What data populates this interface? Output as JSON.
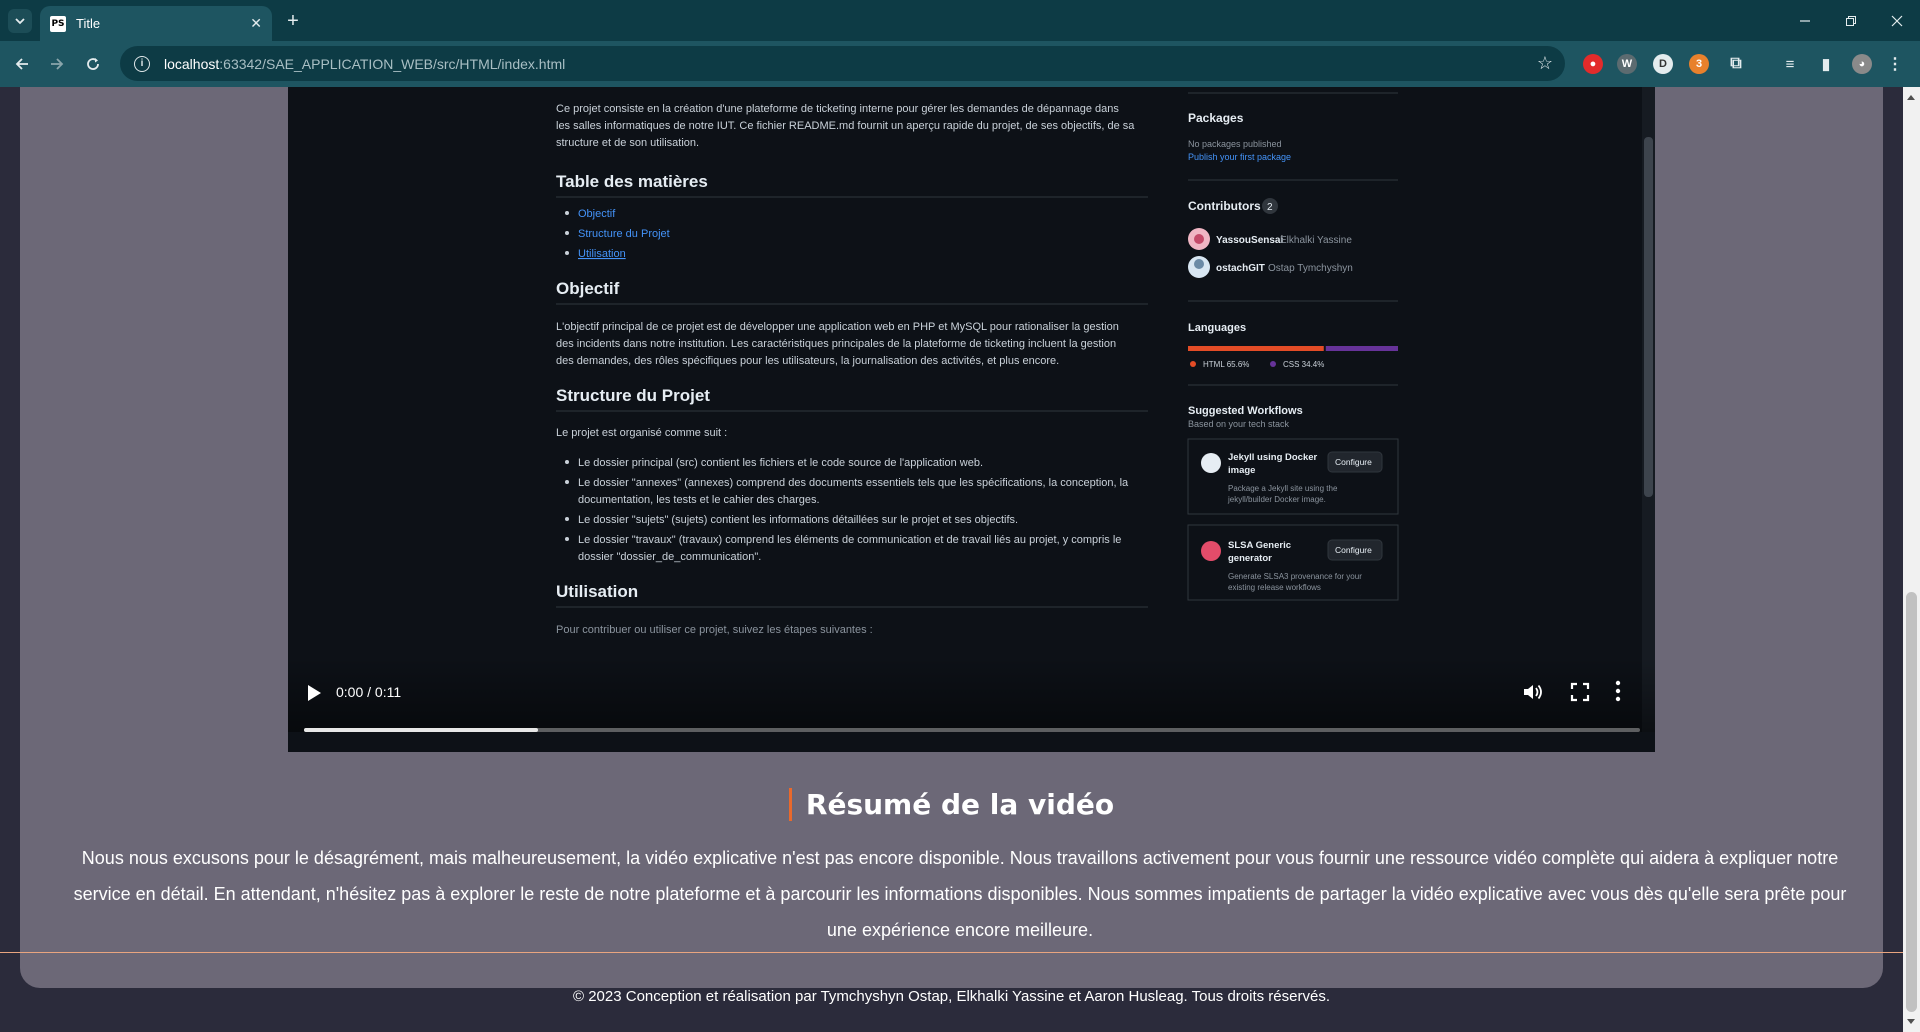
{
  "browser": {
    "tab_title": "Title",
    "tab_favicon_text": "PS",
    "url_host": "localhost",
    "url_rest": ":63342/SAE_APPLICATION_WEB/src/HTML/index.html",
    "extension_badge": "3"
  },
  "video_frame": {
    "intro_line1": "Ce projet consiste en la création d'une plateforme de ticketing interne pour gérer les demandes de dépannage dans",
    "intro_line2": "les salles informatiques de notre IUT. Ce fichier README.md fournit un aperçu rapide du projet, de ses objectifs, de sa",
    "intro_line3": "structure et de son utilisation.",
    "toc_heading": "Table des matières",
    "toc_items": [
      "Objectif",
      "Structure du Projet",
      "Utilisation"
    ],
    "objectif_heading": "Objectif",
    "objectif_line1": "L'objectif principal de ce projet est de développer une application web en PHP et MySQL pour rationaliser la gestion",
    "objectif_line2": "des incidents dans notre institution. Les caractéristiques principales de la plateforme de ticketing incluent la gestion",
    "objectif_line3": "des demandes, des rôles spécifiques pour les utilisateurs, la journalisation des activités, et plus encore.",
    "structure_heading": "Structure du Projet",
    "structure_intro": "Le projet est organisé comme suit :",
    "structure_items": [
      "Le dossier principal (src) contient les fichiers et le code source de l'application web.",
      "Le dossier \"annexes\" (annexes) comprend des documents essentiels tels que les spécifications, la conception, la",
      "documentation, les tests et le cahier des charges.",
      "Le dossier \"sujets\" (sujets) contient les informations détaillées sur le projet et ses objectifs.",
      "Le dossier \"travaux\" (travaux) comprend les éléments de communication et de travail liés au projet, y compris le",
      "dossier \"dossier_de_communication\"."
    ],
    "utilisation_heading": "Utilisation",
    "utilisation_line": "Pour contribuer ou utiliser ce projet, suivez les étapes suivantes :",
    "side_packages": "Packages",
    "side_no_packages": "No packages published",
    "side_publish": "Publish your first package",
    "side_contributors": "Contributors",
    "side_contributors_count": "2",
    "contributor1_user": "YassouSensai",
    "contributor1_name": "Elkhalki Yassine",
    "contributor2_user": "ostachGIT",
    "contributor2_name": "Ostap Tymchyshyn",
    "side_languages": "Languages",
    "lang1": "HTML 65.6%",
    "lang2": "CSS 34.4%",
    "lang1_pct": 65.6,
    "side_workflows": "Suggested Workflows",
    "side_workflows_sub": "Based on your tech stack",
    "wf1_title_1": "Jekyll using Docker",
    "wf1_title_2": "image",
    "wf1_desc_1": "Package a Jekyll site using the",
    "wf1_desc_2": "jekyll/builder Docker image.",
    "wf2_title_1": "SLSA Generic",
    "wf2_title_2": "generator",
    "wf2_desc_1": "Generate SLSA3 provenance for your",
    "wf2_desc_2": "existing release workflows",
    "configure": "Configure"
  },
  "player": {
    "time": "0:00 / 0:11",
    "buffered_fraction": 0.175
  },
  "summary": {
    "title": "Résumé de la vidéo",
    "text": "Nous nous excusons pour le désagrément, mais malheureusement, la vidéo explicative n'est pas encore disponible. Nous travaillons activement pour vous fournir une ressource vidéo complète qui aidera à expliquer notre service en détail. En attendant, n'hésitez pas à explorer le reste de notre plateforme et à parcourir les informations disponibles. Nous sommes impatients de partager la vidéo explicative avec vous dès qu'elle sera prête pour une expérience encore meilleure."
  },
  "footer": {
    "text": "© 2023 Conception et réalisation par Tymchyshyn Ostap, Elkhalki Yassine et Aaron Husleag. Tous droits réservés."
  },
  "colors": {
    "accent": "#e9692c",
    "card": "#6c6877",
    "page_bg": "#2b2b3b",
    "chrome_dark": "#0d3b45",
    "chrome_light": "#1e5561"
  }
}
